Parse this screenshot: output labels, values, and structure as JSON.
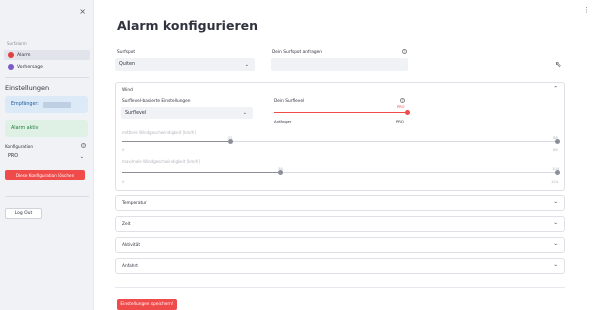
{
  "sidebar": {
    "close_icon": "×",
    "section_label": "Surfalarm",
    "nav": [
      {
        "label": "Alarm",
        "icon": "alarm-icon",
        "color": "#e04040"
      },
      {
        "label": "Vorhersage",
        "icon": "forecast-icon",
        "color": "#7c5cc4"
      }
    ],
    "settings_heading": "Einstellungen",
    "recipient_label": "Empfänger:",
    "alarm_status": "Alarm aktiv",
    "config_label": "Konfiguration",
    "config_value": "PRO",
    "delete_button": "Diese Konfiguration löschen",
    "logout_button": "Log Out"
  },
  "main": {
    "menu_icon": "⋮",
    "title": "Alarm konfigurieren",
    "surfspot_label": "Surfspot",
    "surfspot_value": "Quiten",
    "add_spot_label": "Dein Surfspot anfragen",
    "add_spot_value": "",
    "wind": {
      "header": "Wind",
      "level_settings_label": "Surflevel-basierte Einstellungen",
      "level_select_value": "Surflevel",
      "your_level_label": "Dein Surflevel",
      "level_value_label": "PRO",
      "level_min_label": "Anfänger",
      "level_max_label": "PRO",
      "level_fraction": 1.0,
      "min_speed_label": "mittlere Windgeschwindigkeit [km/h]",
      "min_speed": {
        "value": 22,
        "min": 0,
        "max": 88,
        "min_label": "0",
        "max_label": "88",
        "value_label": "22",
        "end_value_label": "88"
      },
      "max_speed_label": "maximale Windgeschwindigkeit [km/h]",
      "max_speed": {
        "value": 38,
        "min": 0,
        "max": 104,
        "min_label": "0",
        "max_label": "104",
        "value_label": "38",
        "end_value_label": "104"
      }
    },
    "sections": [
      "Temperatur",
      "Zeit",
      "Aktivität",
      "Anfahrt"
    ],
    "save_button": "Einstellungen speichern!"
  },
  "colors": {
    "accent_red": "#f04b4b",
    "slider_gray": "#8c8f99",
    "sidebar_bg": "#f0f2f6"
  }
}
